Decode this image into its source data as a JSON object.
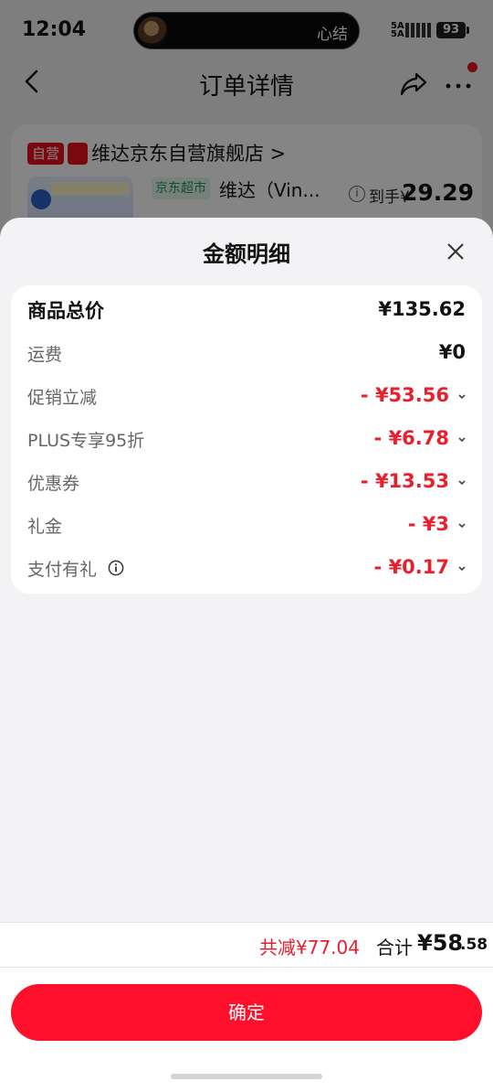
{
  "status_bar": {
    "time": "12:04",
    "island_text": "心结",
    "signal_text": "5A\n5A",
    "battery": "93"
  },
  "nav": {
    "title": "订单详情",
    "icons": [
      "back-icon",
      "share-icon",
      "more-icon"
    ]
  },
  "shop": {
    "badge": "自营",
    "name": "维达京东自营旗舰店 >",
    "tag": "京东超市",
    "product_name": "维达（Vin...",
    "price_label": "到手¥",
    "price_value": "29.29"
  },
  "sheet": {
    "title": "金额明细",
    "rows": [
      {
        "label": "商品总价",
        "value": "¥135.62"
      },
      {
        "label": "运费",
        "value": "¥0"
      },
      {
        "label": "促销立减",
        "value": "- ¥53.56"
      },
      {
        "label": "PLUS专享95折",
        "value": "- ¥6.78"
      },
      {
        "label": "优惠券",
        "value": "- ¥13.53"
      },
      {
        "label": "礼金",
        "value": "- ¥3"
      },
      {
        "label": "支付有礼",
        "value": "- ¥0.17"
      }
    ],
    "footer": {
      "saved": "共减¥77.04",
      "total_label": "合计",
      "total_value": "¥58",
      "total_cents": ".58"
    },
    "confirm": "确定"
  },
  "colors": {
    "accent": "#fe0f2b",
    "discount": "#e8202e",
    "market_green": "#1b9a58"
  }
}
